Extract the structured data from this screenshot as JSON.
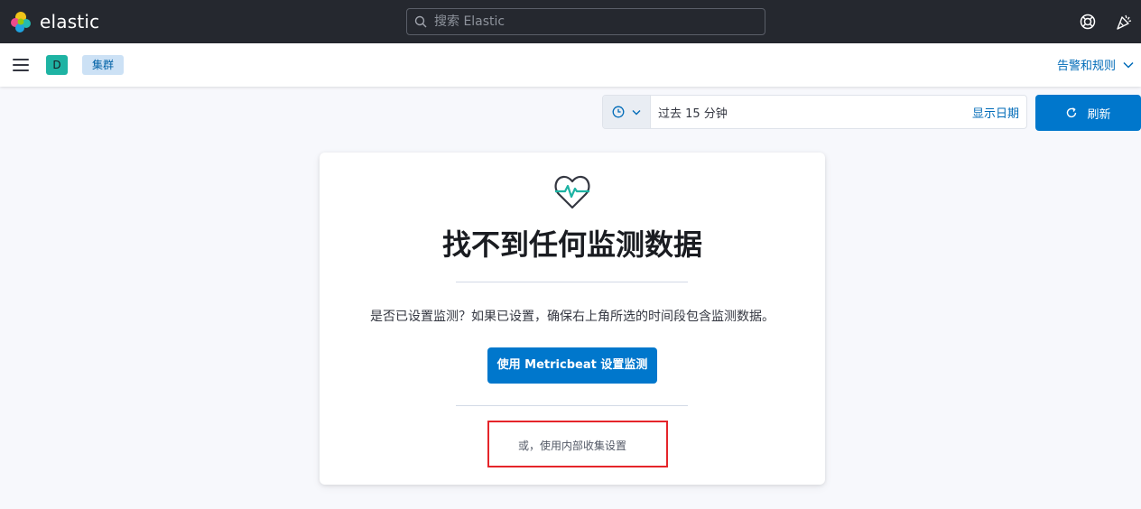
{
  "header": {
    "brand": "elastic",
    "search_placeholder": "搜索 Elastic",
    "help_icon": "help-lifebuoy-icon",
    "news_icon": "newsfeed-party-icon"
  },
  "subheader": {
    "space_initial": "D",
    "breadcrumb": "集群",
    "alerts_menu": "告警和规则"
  },
  "timepicker": {
    "range_label": "过去 15 分钟",
    "show_dates": "显示日期",
    "refresh_label": "刷新"
  },
  "card": {
    "icon": "heartbeat-icon",
    "title": "找不到任何监测数据",
    "description": "是否已设置监测？如果已设置，确保右上角所选的时间段包含监测数据。",
    "metricbeat_button": "使用 Metricbeat 设置监测",
    "internal_link": "或，使用内部收集设置"
  },
  "colors": {
    "header_bg": "#25282f",
    "primary": "#0077cc",
    "link": "#006bb8",
    "space_badge": "#1eb3a3",
    "highlight_box": "#e5252a"
  }
}
